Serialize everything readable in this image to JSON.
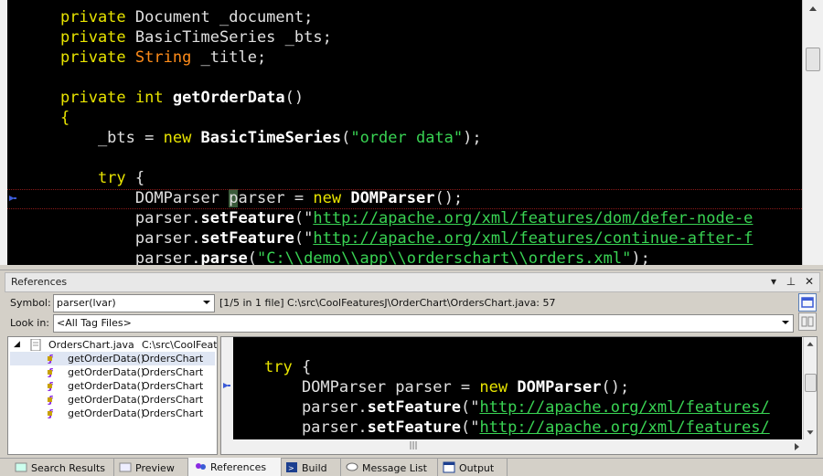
{
  "editor": {
    "lines": [
      [
        [
          "kw",
          "private "
        ],
        [
          "ty",
          "Document _document;"
        ]
      ],
      [
        [
          "kw",
          "private "
        ],
        [
          "ty",
          "BasicTimeSeries _bts;"
        ]
      ],
      [
        [
          "kw",
          "private "
        ],
        [
          "st",
          "String"
        ],
        [
          "ty",
          " _title;"
        ]
      ],
      [],
      [
        [
          "kw",
          "private int "
        ],
        [
          "fn",
          "getOrderData"
        ],
        [
          "pl",
          "()"
        ]
      ],
      [
        [
          "kw",
          "{"
        ]
      ],
      [
        [
          "pl",
          "    _bts = "
        ],
        [
          "kw",
          "new "
        ],
        [
          "fn",
          "BasicTimeSeries"
        ],
        [
          "pl",
          "("
        ],
        [
          "str",
          "\"order data\""
        ],
        [
          "pl",
          ");"
        ]
      ],
      [],
      [
        [
          "kw",
          "    try "
        ],
        [
          "pl",
          "{"
        ]
      ],
      [
        [
          "pl",
          "        DOMParser "
        ],
        [
          "hl",
          "p"
        ],
        [
          "pl",
          "arser = "
        ],
        [
          "kw",
          "new "
        ],
        [
          "fn",
          "DOMParser"
        ],
        [
          "pl",
          "();"
        ]
      ],
      [
        [
          "pl",
          "        parser."
        ],
        [
          "fn",
          "setFeature"
        ],
        [
          "pl",
          "(\""
        ],
        [
          "url",
          "http://apache.org/xml/features/dom/defer-node-e"
        ]
      ],
      [
        [
          "pl",
          "        parser."
        ],
        [
          "fn",
          "setFeature"
        ],
        [
          "pl",
          "(\""
        ],
        [
          "url",
          "http://apache.org/xml/features/continue-after-f"
        ]
      ],
      [
        [
          "pl",
          "        parser."
        ],
        [
          "fn",
          "parse"
        ],
        [
          "pl",
          "("
        ],
        [
          "str",
          "\"C:\\\\demo\\\\app\\\\orderschart\\\\orders.xml\""
        ],
        [
          "pl",
          ");"
        ]
      ]
    ]
  },
  "references": {
    "title": "References",
    "symbol_label": "Symbol:",
    "symbol_value": "parser(lvar)",
    "location_info": "[1/5 in 1 file] C:\\src\\CoolFeaturesJ\\OrderChart\\OrdersChart.java: 57",
    "lookin_label": "Look in:",
    "lookin_value": "<All Tag Files>",
    "tree": {
      "file_name": "OrdersChart.java",
      "file_path": "C:\\src\\CoolFeatu",
      "items": [
        {
          "method": "getOrderData()",
          "cls": "OrdersChart"
        },
        {
          "method": "getOrderData()",
          "cls": "OrdersChart"
        },
        {
          "method": "getOrderData()",
          "cls": "OrdersChart"
        },
        {
          "method": "getOrderData()",
          "cls": "OrdersChart"
        },
        {
          "method": "getOrderData()",
          "cls": "OrdersChart"
        }
      ]
    },
    "preview_lines": [
      [],
      [
        [
          "kw",
          "try "
        ],
        [
          "pl",
          "{"
        ]
      ],
      [
        [
          "pl",
          "    DOMParser parser = "
        ],
        [
          "kw",
          "new "
        ],
        [
          "fn",
          "DOMParser"
        ],
        [
          "pl",
          "();"
        ]
      ],
      [
        [
          "pl",
          "    parser."
        ],
        [
          "fn",
          "setFeature"
        ],
        [
          "pl",
          "(\""
        ],
        [
          "url",
          "http://apache.org/xml/features/"
        ]
      ],
      [
        [
          "pl",
          "    parser."
        ],
        [
          "fn",
          "setFeature"
        ],
        [
          "pl",
          "(\""
        ],
        [
          "url",
          "http://apache.org/xml/features/"
        ]
      ]
    ]
  },
  "tabs": [
    {
      "label": "Search Results",
      "icon": "search-results-icon"
    },
    {
      "label": "Preview",
      "icon": "preview-icon"
    },
    {
      "label": "References",
      "icon": "references-icon",
      "active": true
    },
    {
      "label": "Build",
      "icon": "build-icon"
    },
    {
      "label": "Message List",
      "icon": "message-list-icon"
    },
    {
      "label": "Output",
      "icon": "output-icon"
    }
  ],
  "colors": {
    "keyword": "#e8e400",
    "string": "#39d353",
    "type_string": "#ff8c1a",
    "background": "#000000"
  }
}
